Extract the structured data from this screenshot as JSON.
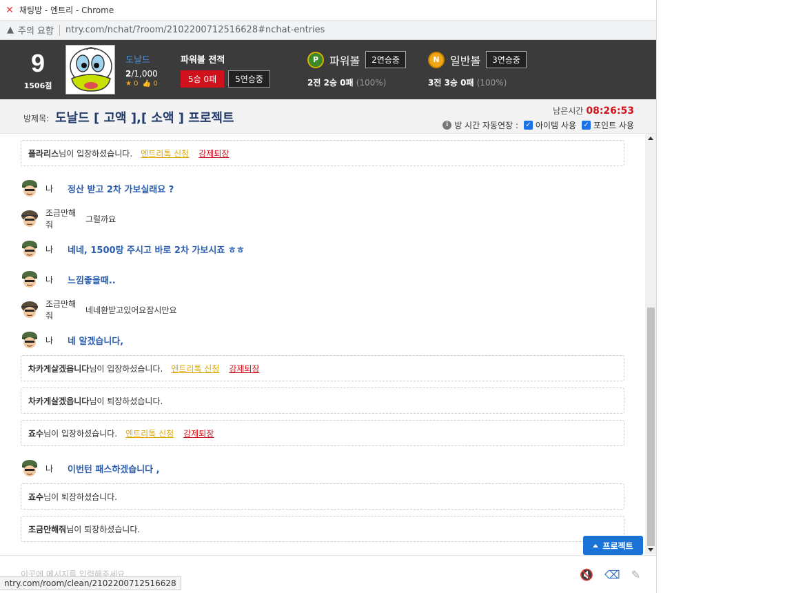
{
  "browser": {
    "tab_title": "채팅방 - 엔트리 - Chrome",
    "security_label": "주의 요함",
    "url": "ntry.com/nchat/?room/2102200712516628#nchat-entries",
    "status_url": "ntry.com/room/clean/2102200712516628"
  },
  "profile": {
    "level": "9",
    "points": "1506점",
    "username": "도날드",
    "count_current": "2",
    "count_rest": "/1,000",
    "stars": "0",
    "likes": "0"
  },
  "powerball_record": {
    "label": "파워볼 전적",
    "wins_losses": "5승 0패",
    "streak": "5연승중"
  },
  "powerball": {
    "icon_letter": "P",
    "name": "파워볼",
    "streak": "2연승중",
    "stats": "2전 2승 0패",
    "pct": "(100%)"
  },
  "normalball": {
    "icon_letter": "N",
    "name": "일반볼",
    "streak": "3연승중",
    "stats": "3전 3승 0패",
    "pct": "(100%)"
  },
  "room": {
    "title_label": "방제목:",
    "title": "도날드 [ 고액 ],[ 소액 ] 프로젝트",
    "remain_label": "남은시간",
    "remain_time": "08:26:53",
    "auto_extend": "방 시간 자동연장 :",
    "opt_item": "아이템 사용",
    "opt_point": "포인트 사용"
  },
  "links": {
    "apply": "엔트리톡 신청",
    "kick": "강제퇴장"
  },
  "chat": {
    "sys1_name": "폴라리스",
    "sys1_text": "님이 입장하셨습니다.",
    "me": "나",
    "m1": "정산 받고 2차 가보실래요 ?",
    "other": "조금만해줘",
    "o1": "그럴까요",
    "m2": "네네, 1500탕 주시고 바로 2차 가보시죠 ㅎㅎ",
    "m3": "느낌좋을때..",
    "o2": "네네환받고있어요잠시만요",
    "m4": "네 알겠습니다,",
    "sys2_name": "차카게살겠읍니다",
    "sys2_text": "님이 입장하셨습니다.",
    "sys3_name": "차카게살겠읍니다",
    "sys3_text": "님이 퇴장하셨습니다.",
    "sys4_name": "죠수",
    "sys4_text": "님이 입장하셨습니다.",
    "m5": "이번턴 패스하겠습니다 ,",
    "sys5_name": "죠수",
    "sys5_text": "님이 퇴장하셨습니다.",
    "sys6_name": "조금만해줘",
    "sys6_text": "님이 퇴장하셨습니다."
  },
  "float_button": "프로젝트",
  "input": {
    "placeholder": "이곳에 메시지를 입력해주세요."
  }
}
